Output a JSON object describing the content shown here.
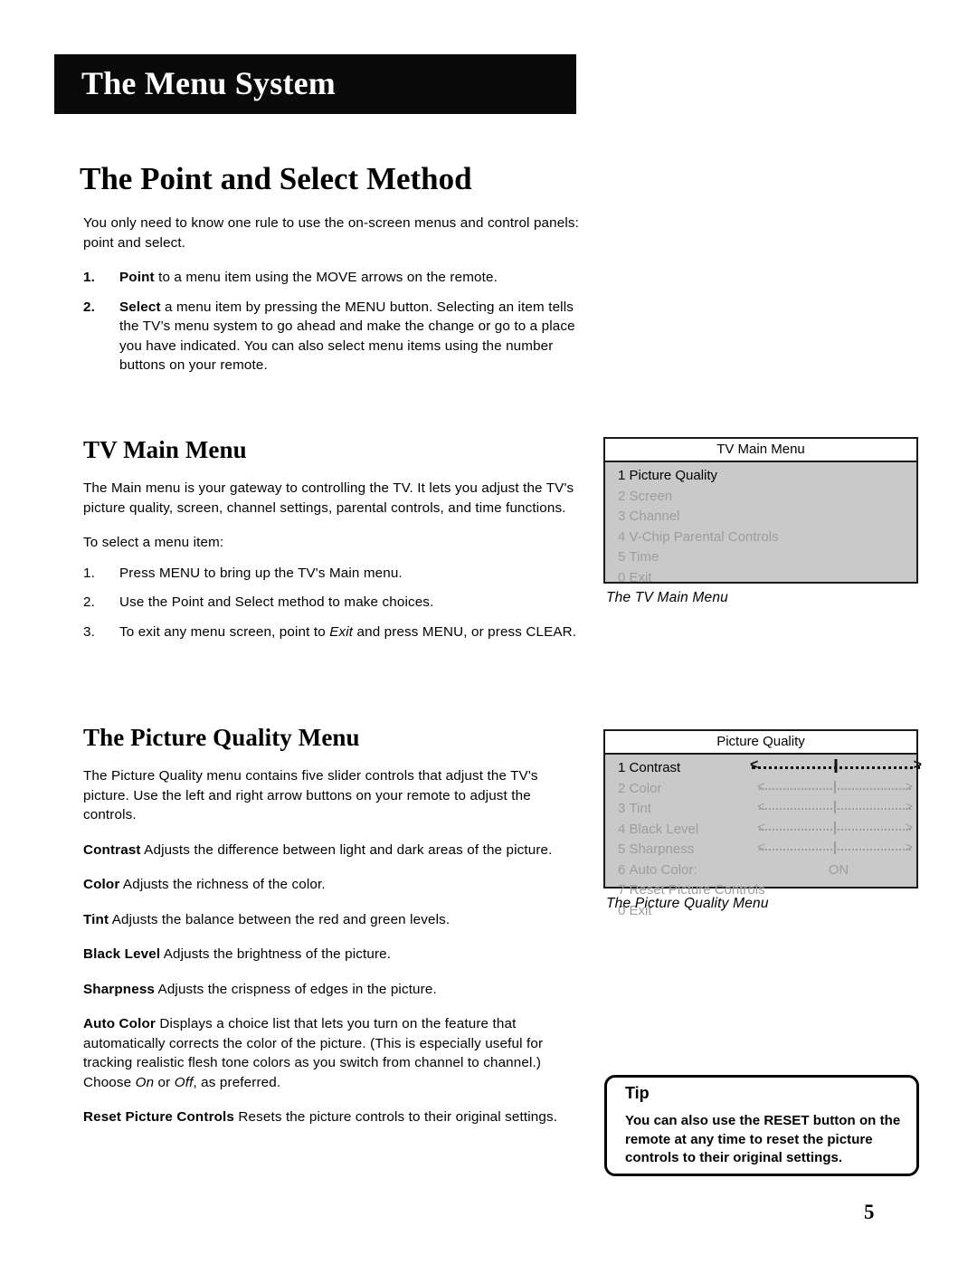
{
  "banner": {
    "title": "The Menu System"
  },
  "page_heading": "The Point and Select Method",
  "intro": {
    "paragraph": "You only need to know one rule to use the on-screen menus and control panels: point and select.",
    "steps": [
      {
        "number": "1.",
        "bold_lead": "Point",
        "text": " to a menu item using the MOVE arrows on the remote."
      },
      {
        "number": "2.",
        "bold_lead": "Select",
        "text": " a menu item by pressing the MENU button. Selecting an item tells the TV’s menu system to go ahead and make the change or go to a place you have indicated. You can also select menu items using the number buttons on your remote."
      }
    ]
  },
  "main_menu_section": {
    "heading": "TV Main Menu",
    "paragraph": "The Main menu is your gateway to controlling the TV.  It lets you adjust the TV's  picture quality, screen, channel settings, parental controls, and time functions.",
    "lead_in": "To select a menu item:",
    "steps": [
      {
        "number": "1.",
        "text": "Press MENU to bring up the TV's Main menu."
      },
      {
        "number": "2.",
        "text": "Use the Point and Select method to make choices."
      },
      {
        "number": "3.",
        "pre": "To exit any menu screen, point to ",
        "italic": "Exit",
        "post": " and press MENU, or press CLEAR."
      }
    ]
  },
  "picture_quality_section": {
    "heading": "The Picture Quality Menu",
    "paragraph": "The Picture Quality menu contains five slider controls that adjust the TV's picture. Use the left and right arrow buttons on your remote to adjust the controls.",
    "definitions": [
      {
        "term": "Contrast",
        "text": " Adjusts the difference between light and dark areas of the picture."
      },
      {
        "term": "Color",
        "text": " Adjusts the richness of the color."
      },
      {
        "term": "Tint",
        "text": " Adjusts the balance between the red and green levels."
      },
      {
        "term": "Black Level",
        "text": " Adjusts the brightness of the picture."
      },
      {
        "term": "Sharpness",
        "text": " Adjusts the crispness of edges in the picture."
      },
      {
        "term": "Reset Picture Controls",
        "text": " Resets the picture controls to their original settings."
      }
    ],
    "auto_color": {
      "term": "Auto Color",
      "part1": " Displays a choice list that lets you turn on the feature that automatically corrects the color of the picture. (This is especially useful for tracking realistic flesh tone colors as you switch from channel to channel.) Choose ",
      "italic1": "On",
      "mid": " or ",
      "italic2": "Off",
      "part2": ", as preferred."
    }
  },
  "tv_main_menu_graphic": {
    "title": "TV Main Menu",
    "items": [
      {
        "number": "1",
        "label": "Picture Quality",
        "selected": true
      },
      {
        "number": "2",
        "label": "Screen",
        "selected": false
      },
      {
        "number": "3",
        "label": "Channel",
        "selected": false
      },
      {
        "number": "4",
        "label": "V-Chip Parental Controls",
        "selected": false
      },
      {
        "number": "5",
        "label": "Time",
        "selected": false
      },
      {
        "number": "0",
        "label": "Exit",
        "selected": false
      }
    ],
    "caption": "The TV Main Menu"
  },
  "picture_quality_graphic": {
    "title": "Picture Quality",
    "items": [
      {
        "number": "1",
        "label": "Contrast",
        "control": "slider",
        "selected": true
      },
      {
        "number": "2",
        "label": "Color",
        "control": "slider",
        "selected": false
      },
      {
        "number": "3",
        "label": "Tint",
        "control": "slider",
        "selected": false
      },
      {
        "number": "4",
        "label": "Black Level",
        "control": "slider",
        "selected": false
      },
      {
        "number": "5",
        "label": "Sharpness",
        "control": "slider",
        "selected": false
      },
      {
        "number": "6",
        "label": "Auto Color:",
        "control": "value",
        "value": "ON",
        "selected": false
      },
      {
        "number": "7",
        "label": "Reset Picture Controls",
        "control": "none",
        "selected": false
      },
      {
        "number": "0",
        "label": "Exit",
        "control": "none",
        "selected": false
      }
    ],
    "caption": "The Picture Quality Menu"
  },
  "tip": {
    "title": "Tip",
    "body": "You can also use the RESET button on the remote at any time to reset the picture controls to their original settings."
  },
  "page_number": "5",
  "colors": {
    "banner_bg": "#0a0a0a",
    "menu_body_bg": "#c9c9c9",
    "menu_dim_text": "#9d9d9d",
    "menu_border": "#1a1a1a"
  }
}
